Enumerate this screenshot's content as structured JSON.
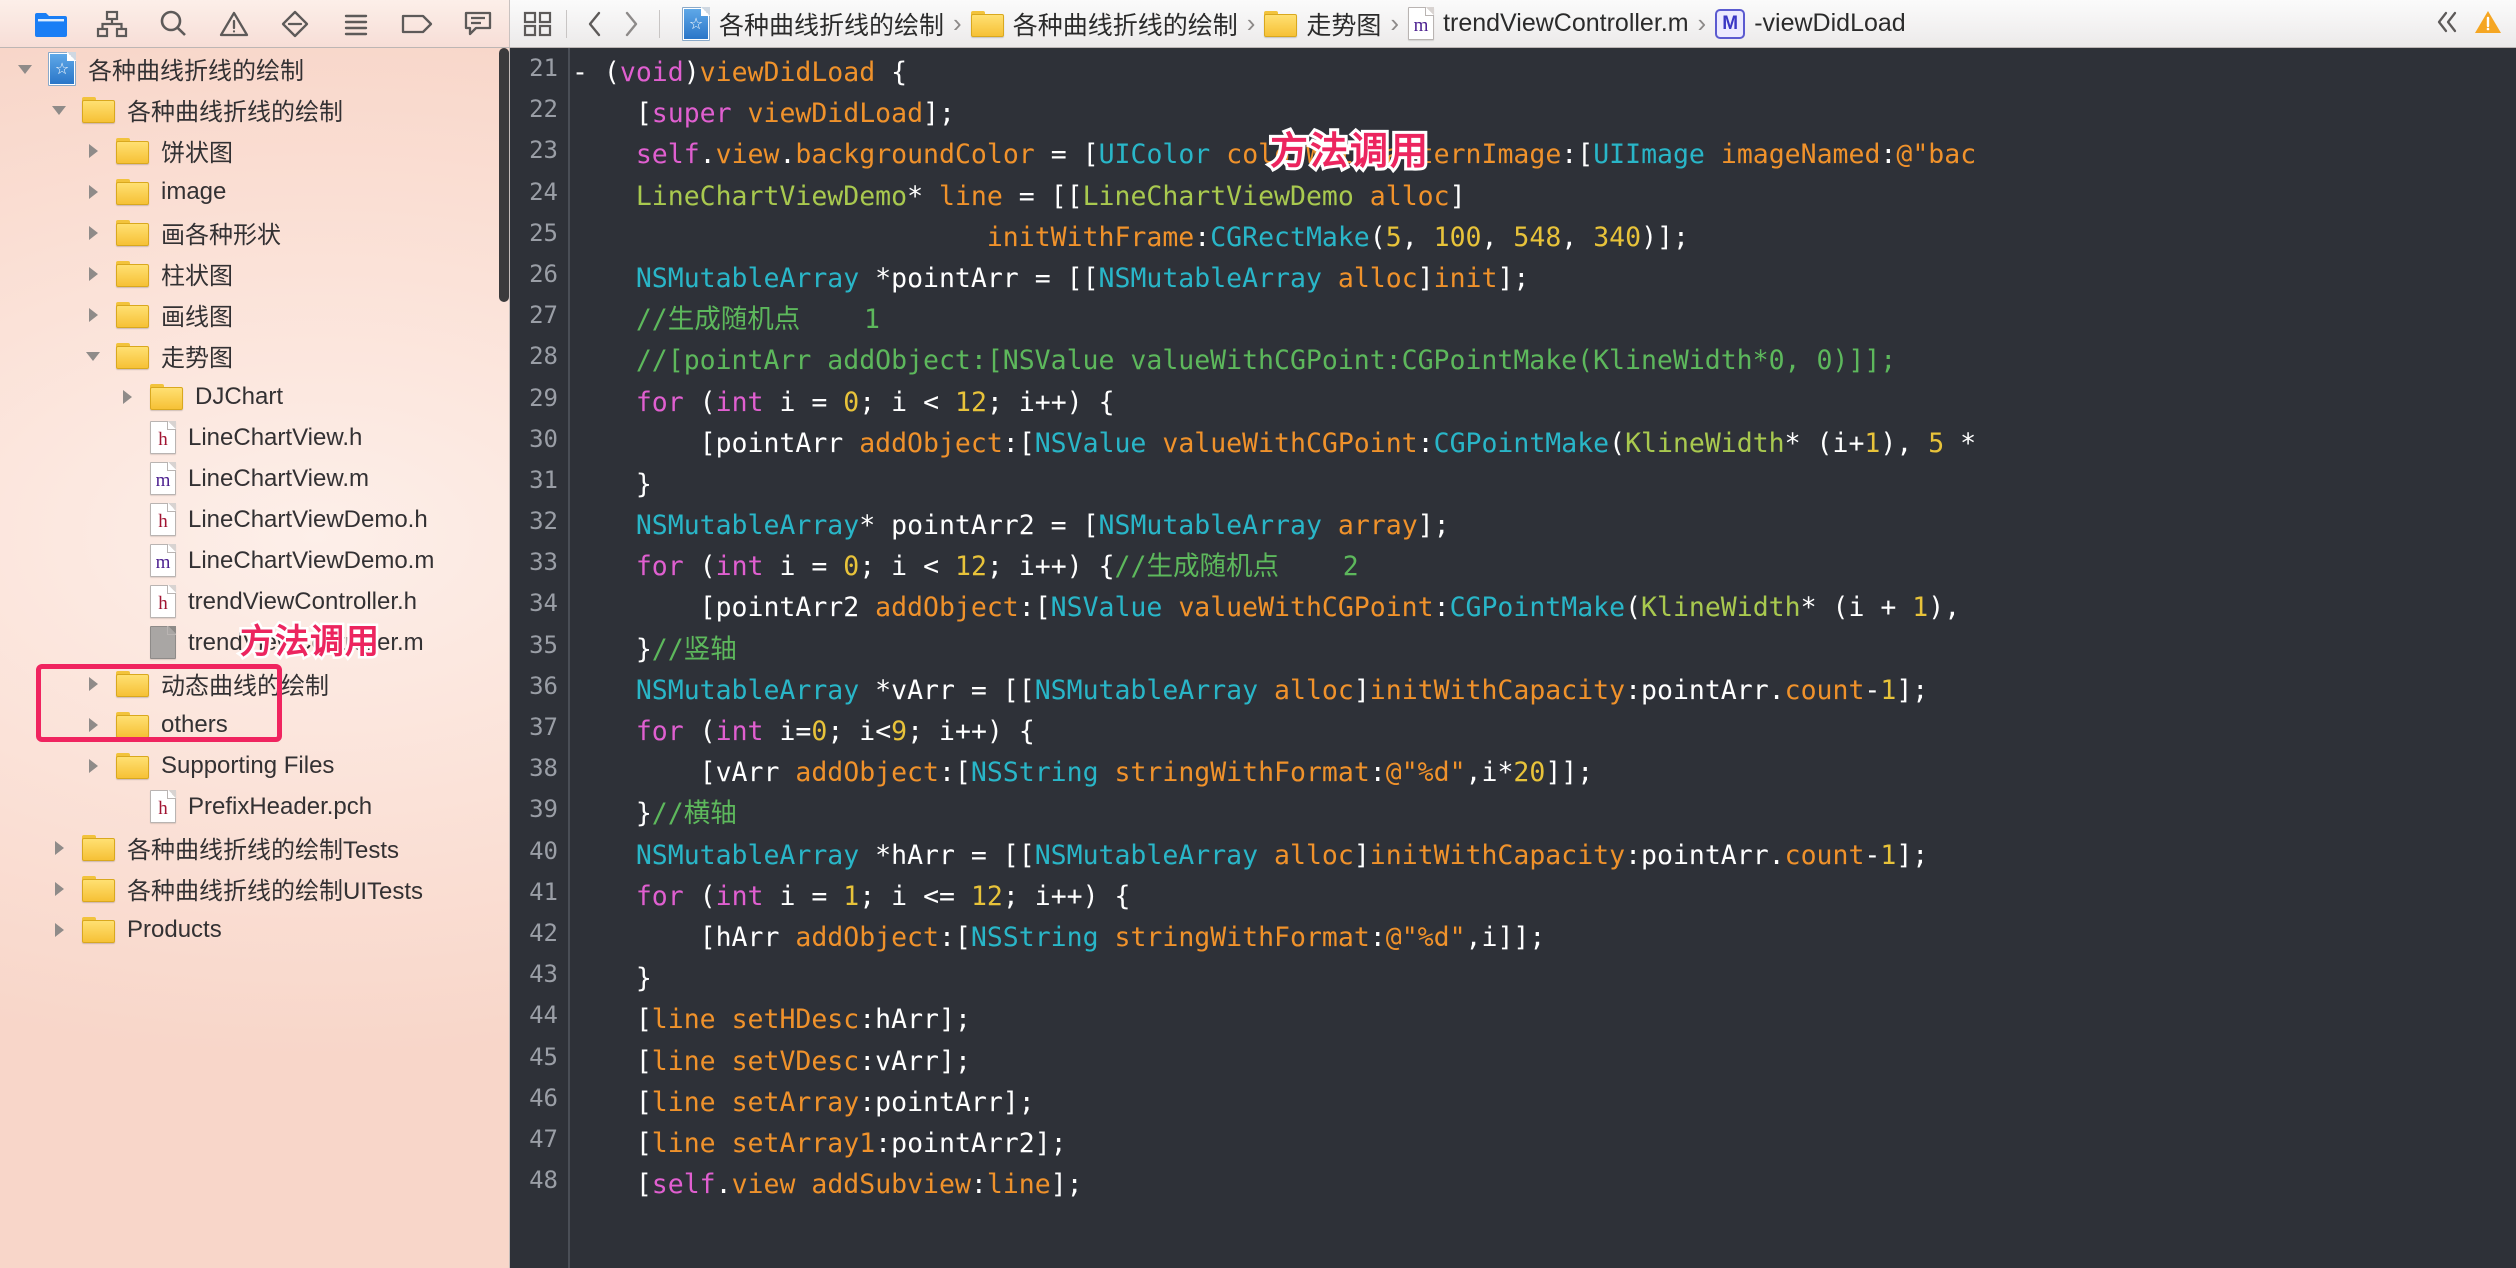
{
  "toolbar": {
    "left_icons": [
      {
        "name": "folder-icon",
        "label": "Project navigator"
      },
      {
        "name": "hierarchy-icon",
        "label": "Symbol navigator"
      },
      {
        "name": "search-icon",
        "label": "Find navigator"
      },
      {
        "name": "warning-icon",
        "label": "Issue navigator"
      },
      {
        "name": "test-icon",
        "label": "Test navigator"
      },
      {
        "name": "debug-icon",
        "label": "Debug navigator"
      },
      {
        "name": "breakpoint-icon",
        "label": "Breakpoint navigator"
      },
      {
        "name": "report-icon",
        "label": "Report navigator"
      }
    ],
    "editor_layout_icon": "editor-layout-icon",
    "back_label": "‹",
    "forward_label": "›",
    "right_icons": [
      {
        "name": "hide-utilities-icon",
        "label": "‹‹"
      },
      {
        "name": "warning-status-icon",
        "label": "⚠"
      }
    ]
  },
  "breadcrumb": {
    "separator": "›",
    "items": [
      {
        "label": "各种曲线折线的绘制",
        "icon": "project-icon"
      },
      {
        "label": "各种曲线折线的绘制",
        "icon": "folder-icon"
      },
      {
        "label": "走势图",
        "icon": "folder-icon"
      },
      {
        "label": "trendViewController.m",
        "icon": "m-file-icon"
      },
      {
        "label": "-viewDidLoad",
        "icon": "method-icon"
      }
    ]
  },
  "navigator": {
    "rows": [
      {
        "indent": 0,
        "twisty": "down",
        "icon": "project-icon",
        "label": "各种曲线折线的绘制"
      },
      {
        "indent": 1,
        "twisty": "down",
        "icon": "folder-icon",
        "label": "各种曲线折线的绘制"
      },
      {
        "indent": 2,
        "twisty": "right",
        "icon": "folder-icon",
        "label": "饼状图"
      },
      {
        "indent": 2,
        "twisty": "right",
        "icon": "folder-icon",
        "label": "image"
      },
      {
        "indent": 2,
        "twisty": "right",
        "icon": "folder-icon",
        "label": "画各种形状"
      },
      {
        "indent": 2,
        "twisty": "right",
        "icon": "folder-icon",
        "label": "柱状图"
      },
      {
        "indent": 2,
        "twisty": "right",
        "icon": "folder-icon",
        "label": "画线图"
      },
      {
        "indent": 2,
        "twisty": "down",
        "icon": "folder-icon",
        "label": "走势图"
      },
      {
        "indent": 3,
        "twisty": "right",
        "icon": "folder-icon",
        "label": "DJChart"
      },
      {
        "indent": 3,
        "twisty": "none",
        "icon": "h-file-icon",
        "label": "LineChartView.h"
      },
      {
        "indent": 3,
        "twisty": "none",
        "icon": "m-file-icon",
        "label": "LineChartView.m"
      },
      {
        "indent": 3,
        "twisty": "none",
        "icon": "h-file-icon",
        "label": "LineChartViewDemo.h"
      },
      {
        "indent": 3,
        "twisty": "none",
        "icon": "m-file-icon",
        "label": "LineChartViewDemo.m"
      },
      {
        "indent": 3,
        "twisty": "none",
        "icon": "h-file-icon",
        "label": "trendViewController.h"
      },
      {
        "indent": 3,
        "twisty": "none",
        "icon": "m-file-icon-grey",
        "label": "trendViewController.m"
      },
      {
        "indent": 2,
        "twisty": "right",
        "icon": "folder-icon",
        "label": "动态曲线的绘制"
      },
      {
        "indent": 2,
        "twisty": "right",
        "icon": "folder-icon",
        "label": "others"
      },
      {
        "indent": 2,
        "twisty": "right",
        "icon": "folder-icon",
        "label": "Supporting Files"
      },
      {
        "indent": 3,
        "twisty": "none",
        "icon": "h-file-icon",
        "label": "PrefixHeader.pch"
      },
      {
        "indent": 1,
        "twisty": "right",
        "icon": "folder-icon",
        "label": "各种曲线折线的绘制Tests"
      },
      {
        "indent": 1,
        "twisty": "right",
        "icon": "folder-icon",
        "label": "各种曲线折线的绘制UITests"
      },
      {
        "indent": 1,
        "twisty": "right",
        "icon": "folder-icon",
        "label": "Products"
      }
    ]
  },
  "annotations": {
    "sidebar_label": "方法调用",
    "editor_label": "方法调用",
    "box_color": "#f0245f",
    "text_color": "#ec255f"
  },
  "editor": {
    "first_line_number": 21,
    "line_numbers": [
      21,
      22,
      23,
      24,
      25,
      26,
      27,
      28,
      29,
      30,
      31,
      32,
      33,
      34,
      35,
      36,
      37,
      38,
      39,
      40,
      41,
      42,
      43,
      44,
      45,
      46,
      47,
      48
    ],
    "lines": [
      "- (void)viewDidLoad {",
      "    [super viewDidLoad];",
      "    self.view.backgroundColor = [UIColor colorWithPatternImage:[UIImage imageNamed:@\"bac",
      "    LineChartViewDemo* line = [[LineChartViewDemo alloc]",
      "                          initWithFrame:CGRectMake(5, 100, 548, 340)];",
      "    NSMutableArray *pointArr = [[NSMutableArray alloc]init];",
      "    //生成随机点    1",
      "    //[pointArr addObject:[NSValue valueWithCGPoint:CGPointMake(KlineWidth*0, 0)]];",
      "    for (int i = 0; i < 12; i++) {",
      "        [pointArr addObject:[NSValue valueWithCGPoint:CGPointMake(KlineWidth* (i+1), 5 *",
      "    }",
      "    NSMutableArray* pointArr2 = [NSMutableArray array];",
      "    for (int i = 0; i < 12; i++) {//生成随机点    2",
      "        [pointArr2 addObject:[NSValue valueWithCGPoint:CGPointMake(KlineWidth* (i + 1),",
      "    }//竖轴",
      "    NSMutableArray *vArr = [[NSMutableArray alloc]initWithCapacity:pointArr.count-1];",
      "    for (int i=0; i<9; i++) {",
      "        [vArr addObject:[NSString stringWithFormat:@\"%d\",i*20]];",
      "    }//横轴",
      "    NSMutableArray *hArr = [[NSMutableArray alloc]initWithCapacity:pointArr.count-1];",
      "    for (int i = 1; i <= 12; i++) {",
      "        [hArr addObject:[NSString stringWithFormat:@\"%d\",i]];",
      "    }",
      "    [line setHDesc:hArr];",
      "    [line setVDesc:vArr];",
      "    [line setArray:pointArr];",
      "    [line setArray1:pointArr2];",
      "    [self.view addSubview:line];"
    ]
  },
  "colors": {
    "editor_background": "#2e3138",
    "gutter_text": "#9a9ea6",
    "keyword": "#e05fd0",
    "class_name": "#29b6c8",
    "selector": "#f0922b",
    "comment": "#5db85c",
    "number": "#e8c33a",
    "user_type": "#a9c94f",
    "plain_text": "#ffffff",
    "navigator_background": "#fbe2d8"
  }
}
